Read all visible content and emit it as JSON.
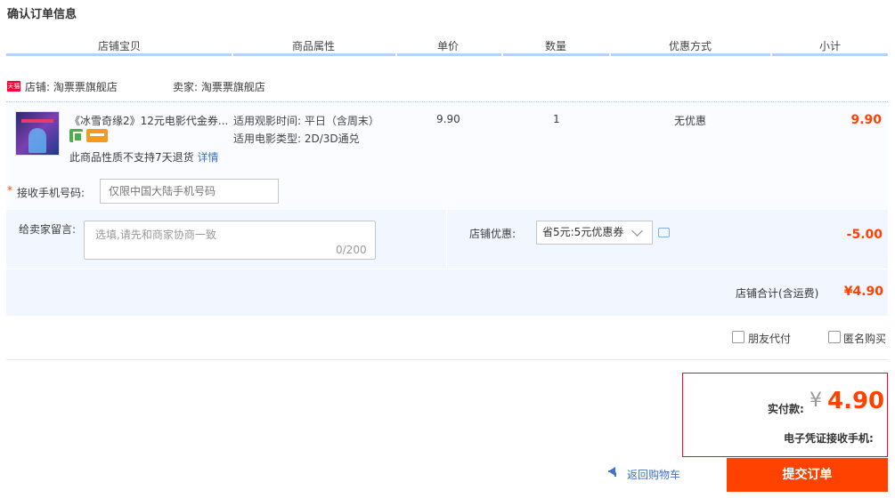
{
  "page_title": "确认订单信息",
  "columns": [
    "店铺宝贝",
    "商品属性",
    "单价",
    "数量",
    "优惠方式",
    "小计"
  ],
  "shop": {
    "badge": "天猫",
    "shop_label": "店铺: 淘票票旗舰店",
    "seller_label": "卖家: 淘票票旗舰店"
  },
  "item": {
    "title": "《冰雪奇缘2》12元电影代金券...",
    "attr1": "适用观影时间: 平日（含周末）",
    "attr2": "适用电影类型: 2D/3D通兑",
    "no_return": "此商品性质不支持7天退货",
    "detail_link": "详情",
    "price": "9.90",
    "quantity": "1",
    "discount": "无优惠",
    "subtotal": "9.90"
  },
  "phone": {
    "required_mark": "*",
    "label": "接收手机号码:",
    "placeholder": "仅限中国大陆手机号码"
  },
  "message": {
    "label": "给卖家留言:",
    "placeholder": "选填,请先和商家协商一致",
    "counter": "0/200"
  },
  "shop_discount": {
    "label": "店铺优惠:",
    "selected": "省5元:5元优惠券",
    "amount": "-5.00"
  },
  "shop_total": {
    "label": "店铺合计(含运费)",
    "value": "¥4.90"
  },
  "options": {
    "friend_pay": "朋友代付",
    "anonymous": "匿名购买"
  },
  "payment": {
    "label": "实付款:",
    "currency": "¥",
    "amount": "4.90",
    "voucher_phone_label": "电子凭证接收手机:"
  },
  "actions": {
    "back_label": "返回购物车",
    "submit_label": "提交订单"
  }
}
